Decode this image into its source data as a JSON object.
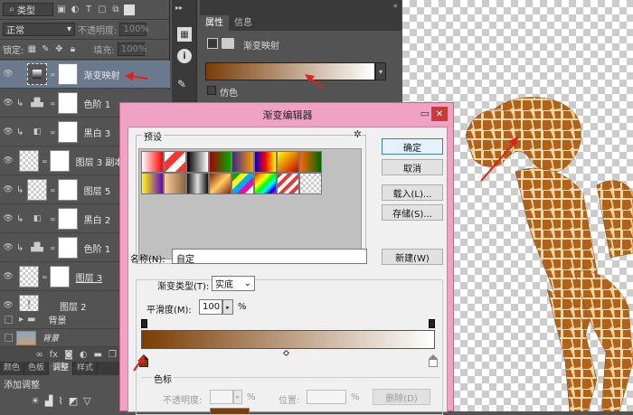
{
  "layers_panel": {
    "filter_label": "类型",
    "blend_mode": "正常",
    "opacity_label": "不透明度:",
    "opacity_value": "100%",
    "lock_label": "锁定:",
    "fill_label": "填充:",
    "fill_value": "100%",
    "layers": [
      {
        "name": "渐变映射",
        "type": "adjustment",
        "selected": true
      },
      {
        "name": "色阶 1",
        "type": "adjustment"
      },
      {
        "name": "黑白 3",
        "type": "adjustment"
      },
      {
        "name": "图层 3 副本",
        "type": "masked"
      },
      {
        "name": "图层 5",
        "type": "masked"
      },
      {
        "name": "黑白 2",
        "type": "adjustment"
      },
      {
        "name": "色阶 1",
        "type": "adjustment"
      },
      {
        "name": "图层 3",
        "type": "masked"
      },
      {
        "name": "图层 2",
        "type": "pixel"
      },
      {
        "name": "背景",
        "type": "group"
      },
      {
        "name": "背景",
        "type": "pixel"
      }
    ],
    "bottom_tabs": [
      "颜色",
      "色板",
      "调整",
      "样式"
    ],
    "active_tab": "调整",
    "add_adjustment_label": "添加调整"
  },
  "properties_panel": {
    "tabs": [
      "属性",
      "信息"
    ],
    "title": "渐变映射",
    "dither_label": "仿色",
    "gradient_colors": [
      "#7a3d06",
      "#ffffff"
    ]
  },
  "gradient_editor": {
    "title": "渐变编辑器",
    "presets_label": "预设",
    "ok_button": "确定",
    "cancel_button": "取消",
    "load_button": "载入(L)...",
    "save_button": "存储(S)...",
    "name_label": "名称(N):",
    "name_value": "自定",
    "new_button": "新建(W)",
    "gradient_type_label": "渐变类型(T):",
    "gradient_type_value": "实底",
    "smoothness_label": "平滑度(M):",
    "smoothness_value": "100",
    "smoothness_unit": "%",
    "stops_group_label": "色标",
    "stop_opacity_label": "不透明度:",
    "stop_opacity_unit": "%",
    "location_label": "位置:",
    "location_unit": "%",
    "delete_button": "删除(D)",
    "gradient_start_color": "#7a3d06",
    "gradient_end_color": "#ffffff"
  },
  "colors": {
    "selection": "#6a7a8c",
    "arrow": "#e0201c",
    "dialog_frame": "#f0a2c4"
  }
}
